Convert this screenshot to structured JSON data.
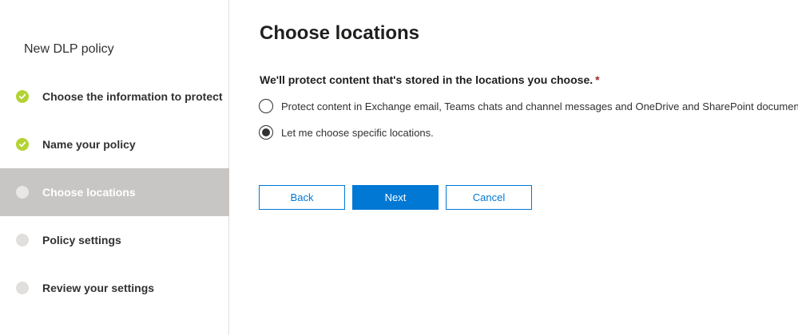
{
  "sidebar": {
    "title": "New DLP policy",
    "steps": [
      {
        "label": "Choose the information to protect",
        "status": "completed",
        "icon": "check-icon"
      },
      {
        "label": "Name your policy",
        "status": "completed",
        "icon": "check-icon"
      },
      {
        "label": "Choose locations",
        "status": "current",
        "icon": "dot-icon"
      },
      {
        "label": "Policy settings",
        "status": "pending",
        "icon": "dot-icon"
      },
      {
        "label": "Review your settings",
        "status": "pending",
        "icon": "dot-icon"
      }
    ]
  },
  "main": {
    "title": "Choose locations",
    "question": "We'll protect content that's stored in the locations you choose.",
    "required_marker": "*",
    "options": [
      {
        "label": "Protect content in Exchange email, Teams chats and channel messages and OneDrive and SharePoint documents.",
        "selected": false
      },
      {
        "label": "Let me choose specific locations.",
        "selected": true
      }
    ]
  },
  "buttons": {
    "back": "Back",
    "next": "Next",
    "cancel": "Cancel"
  },
  "colors": {
    "accent": "#0078d4",
    "completed": "#b3d334",
    "active_step_bg": "#c8c6c4",
    "required": "#a4262c"
  }
}
